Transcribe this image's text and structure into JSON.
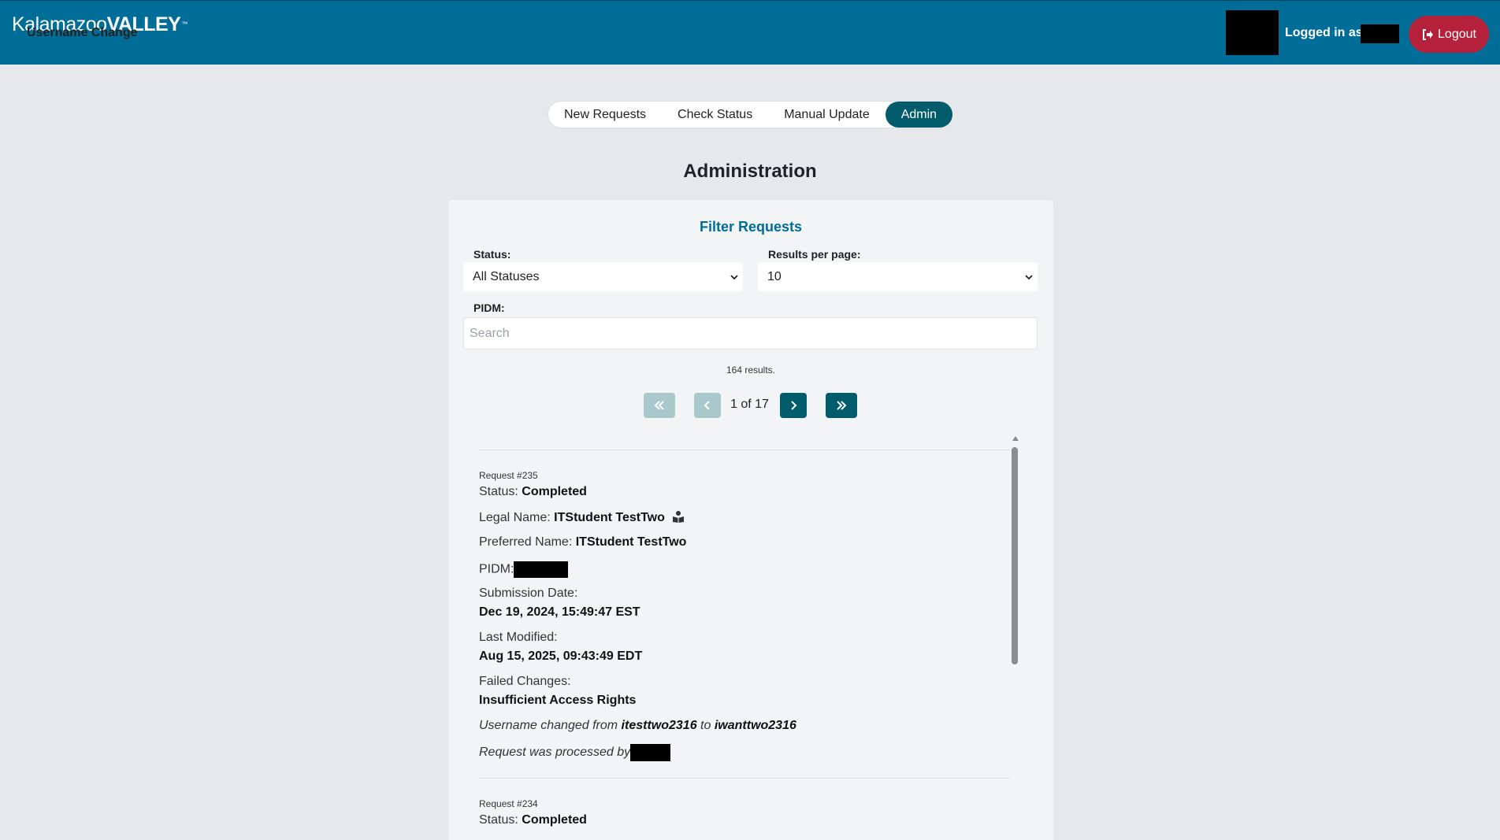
{
  "header": {
    "brand_part1": "Kalamazoo",
    "brand_part2": "VALLEY",
    "brand_tm": "™",
    "subtitle": "Username Change",
    "logged_in_label": "Logged in as,",
    "logout_label": "Logout"
  },
  "tabs": [
    "New Requests",
    "Check Status",
    "Manual Update",
    "Admin"
  ],
  "active_tab": "Admin",
  "page_title": "Administration",
  "filter": {
    "title": "Filter Requests",
    "status_label": "Status:",
    "status_value": "All Statuses",
    "per_page_label": "Results per page:",
    "per_page_value": "10",
    "pidm_label": "PIDM:",
    "pidm_placeholder": "Search"
  },
  "results_text": "164 results.",
  "pagination": {
    "current_page": 1,
    "total_pages": 17,
    "indicator": "1 of 17"
  },
  "requests": [
    {
      "number_label": "Request #235",
      "status_label": "Status:",
      "status": "Completed",
      "legal_name_label": "Legal Name:",
      "legal_name": "ITStudent TestTwo",
      "preferred_name_label": "Preferred Name:",
      "preferred_name": "ITStudent TestTwo",
      "pidm_label": "PIDM:",
      "submission_label": "Submission Date:",
      "submission_date": "Dec 19, 2024, 15:49:47 EST",
      "modified_label": "Last Modified:",
      "modified_date": "Aug 15, 2025, 09:43:49 EDT",
      "failed_label": "Failed Changes:",
      "failed_changes": "Insufficient Access Rights",
      "change_prefix": "Username changed from",
      "old_username": "itesttwo2316",
      "change_mid": "to",
      "new_username": "iwanttwo2316",
      "processed_by_label": "Request was processed by"
    },
    {
      "number_label": "Request #234",
      "status_label": "Status:",
      "status": "Completed"
    }
  ],
  "colors": {
    "header_bg": "#006d99",
    "logout_bg": "#b5213a",
    "active_tab_bg": "#005c6b",
    "accent_title": "#006d99"
  },
  "icons": {
    "logout": "sign-out-icon",
    "legal_name": "id-card-icon",
    "first": "double-chevron-left-icon",
    "prev": "chevron-left-icon",
    "next": "chevron-right-icon",
    "last": "double-chevron-right-icon",
    "select": "chevron-down-icon"
  }
}
